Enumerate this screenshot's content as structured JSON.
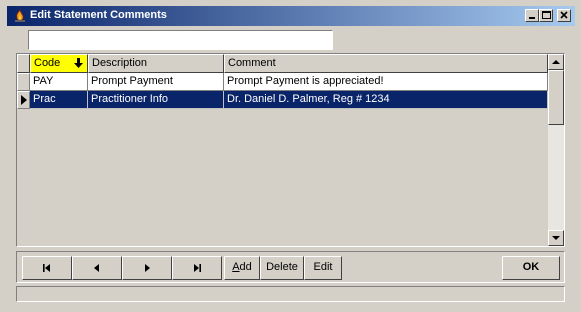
{
  "window": {
    "title": "Edit Statement Comments",
    "icons": {
      "app": "fire-icon",
      "minimize": "minimize-icon",
      "maximize": "maximize-icon",
      "close": "close-icon"
    }
  },
  "filter": {
    "value": ""
  },
  "grid": {
    "columns": [
      {
        "label": "Code",
        "sorted": true,
        "sort_icon": "sort-down-arrow-icon"
      },
      {
        "label": "Description"
      },
      {
        "label": "Comment"
      }
    ],
    "rows": [
      {
        "code": "PAY",
        "description": "Prompt Payment",
        "comment": "Prompt Payment is appreciated!",
        "selected": false
      },
      {
        "code": "Prac",
        "description": "Practitioner Info",
        "comment": "Dr. Daniel D. Palmer, Reg # 1234",
        "selected": true
      }
    ],
    "current_row_icon": "current-record-triangle-icon",
    "scrollbar_icons": {
      "up": "scroll-up-icon",
      "down": "scroll-down-icon"
    }
  },
  "navigator": {
    "first_icon": "first-record-icon",
    "prior_icon": "prior-record-icon",
    "next_icon": "next-record-icon",
    "last_icon": "last-record-icon",
    "add_label_access": "A",
    "add_label_rest": "dd",
    "delete_label": "Delete",
    "edit_label": "Edit",
    "ok_label": "OK"
  },
  "colors": {
    "title_start": "#0a246a",
    "title_end": "#a6caf0",
    "selection": "#0a246a",
    "sorted_header": "#ffff00",
    "face": "#d4d0c8"
  }
}
